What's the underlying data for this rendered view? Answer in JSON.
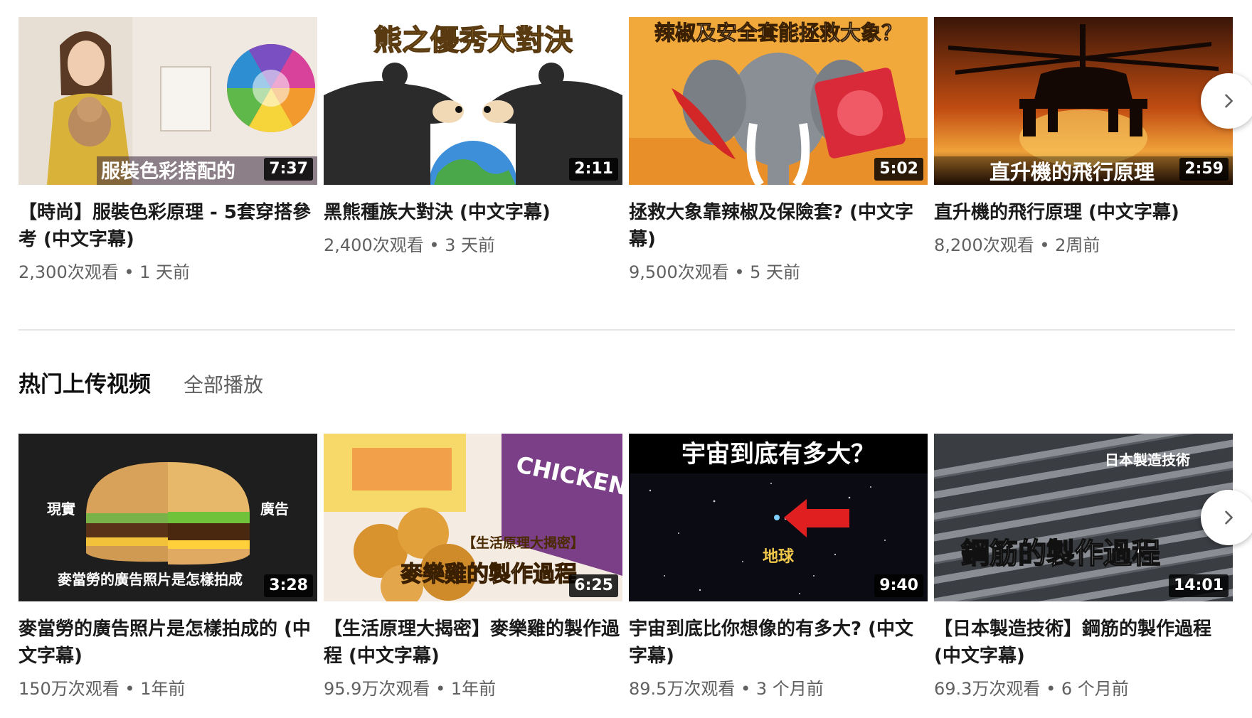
{
  "shelf1": {
    "videos": [
      {
        "title": "【時尚】服裝色彩原理 - 5套穿搭參考 (中文字幕)",
        "duration": "7:37",
        "meta": "2,300次观看 • 1 天前",
        "thumb_text": "服裝色彩搭配的"
      },
      {
        "title": "黑熊種族大對決 (中文字幕)",
        "duration": "2:11",
        "meta": "2,400次观看 • 3 天前",
        "thumb_text": "熊之優秀大對決"
      },
      {
        "title": "拯救大象靠辣椒及保險套? (中文字幕)",
        "duration": "5:02",
        "meta": "9,500次观看 • 5 天前",
        "thumb_text": "辣椒及安全套能拯救大象？"
      },
      {
        "title": "直升機的飛行原理 (中文字幕)",
        "duration": "2:59",
        "meta": "8,200次观看 • 2周前",
        "thumb_text": "直升機的飛行原理"
      }
    ]
  },
  "section": {
    "title": "热门上传视频",
    "play_all": "全部播放"
  },
  "shelf2": {
    "videos": [
      {
        "title": "麥當勞的廣告照片是怎樣拍成的 (中文字幕)",
        "duration": "3:28",
        "meta": "150万次观看 • 1年前",
        "thumb_text": "麥當勞的廣告照片是怎樣拍成",
        "thumb_left": "現實",
        "thumb_right": "廣告"
      },
      {
        "title": "【生活原理大揭密】麥樂雞的製作過程 (中文字幕)",
        "duration": "6:25",
        "meta": "95.9万次观看 • 1年前",
        "thumb_text": "麥樂雞的製作過程",
        "thumb_tag": "【生活原理大揭密】",
        "thumb_box": "CHICKEN McNUGGETS"
      },
      {
        "title": "宇宙到底比你想像的有多大? (中文字幕)",
        "duration": "9:40",
        "meta": "89.5万次观看 • 3 个月前",
        "thumb_text": "宇宙到底有多大？",
        "thumb_label": "地球"
      },
      {
        "title": "【日本製造技術】鋼筋的製作過程 (中文字幕)",
        "duration": "14:01",
        "meta": "69.3万次观看 • 6 个月前",
        "thumb_text": "鋼筋的製作過程",
        "thumb_tag": "日本製造技術"
      }
    ]
  },
  "icons": {
    "next": "chevron-right-icon"
  },
  "colors": {
    "meta": "#606060",
    "divider": "#e5e5e5",
    "duration_bg": "#000000"
  }
}
